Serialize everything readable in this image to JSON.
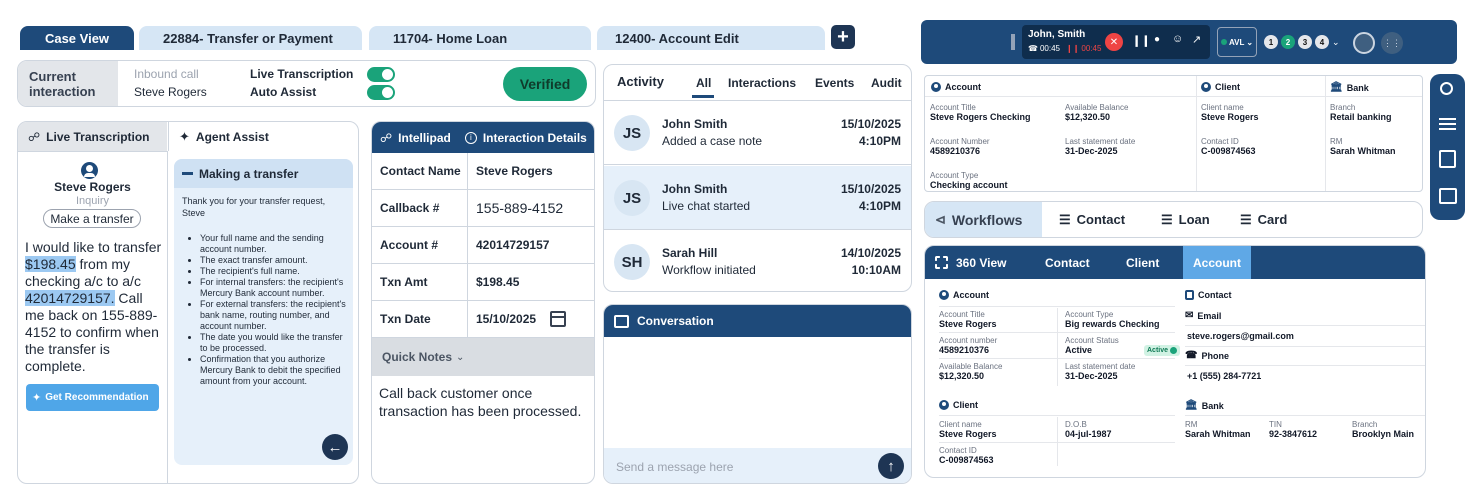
{
  "tabs": [
    {
      "label": "Case View"
    },
    {
      "label": "22884- Transfer or Payment"
    },
    {
      "label": "11704- Home Loan"
    },
    {
      "label": "12400- Account Edit"
    }
  ],
  "add_tab_icon": "plus-icon",
  "current_interaction": {
    "label": "Current interaction",
    "channel": "Inbound call",
    "customer": "Steve Rogers",
    "live_transcription_label": "Live Transcription",
    "auto_assist_label": "Auto Assist",
    "verified_label": "Verified",
    "toggle_color": "#1aa37a"
  },
  "transcription": {
    "tab_label": "Live Transcription",
    "agent_assist_label": "Agent Assist",
    "caller_name": "Steve Rogers",
    "caller_type": "Inquiry",
    "intent_chip": "Make a transfer",
    "text_parts": [
      "I would like to transfer ",
      "$198.45",
      " from my checking a/c to a/c ",
      "42014729157.",
      " Call me back on 155-889-4152 to confirm when the transfer is complete."
    ],
    "recommend_button": "Get Recommendation"
  },
  "agent_assist": {
    "title": "Making a transfer",
    "intro": "Thank you for your transfer request, Steve",
    "steps": [
      "Your full name and the sending account number.",
      "The exact transfer amount.",
      "The recipient's full name.",
      "For internal transfers: the recipient's Mercury Bank account number.",
      "For external transfers: the recipient's bank name, routing number, and account number.",
      "The date you would like the transfer to be processed.",
      "Confirmation that you authorize Mercury Bank to debit the specified amount from your account."
    ]
  },
  "intellipad": {
    "tab_label": "Intellipad",
    "details_label": "Interaction Details",
    "rows": [
      {
        "key": "Contact Name",
        "value": "Steve Rogers"
      },
      {
        "key": "Callback #",
        "value": "155-889-4152"
      },
      {
        "key": "Account #",
        "value": "42014729157"
      },
      {
        "key": "Txn Amt",
        "value": "$198.45"
      },
      {
        "key": "Txn Date",
        "value": "15/10/2025"
      }
    ],
    "quick_notes_label": "Quick Notes",
    "note": "Call back customer once transaction has been processed."
  },
  "activity": {
    "title": "Activity",
    "filters": [
      "All",
      "Interactions",
      "Events",
      "Audit"
    ],
    "items": [
      {
        "initials": "JS",
        "name": "John Smith",
        "action": "Added a case note",
        "date": "15/10/2025",
        "time": "4:10PM"
      },
      {
        "initials": "JS",
        "name": "John Smith",
        "action": "Live chat started",
        "date": "15/10/2025",
        "time": "4:10PM"
      },
      {
        "initials": "SH",
        "name": "Sarah Hill",
        "action": "Workflow initiated",
        "date": "14/10/2025",
        "time": "10:10AM"
      }
    ]
  },
  "conversation": {
    "title": "Conversation",
    "placeholder": "Send a message here"
  },
  "call_bar": {
    "caller": "John, Smith",
    "timer": "00:45",
    "hold_timer": "00:45",
    "status": "AVL",
    "lines": [
      "1",
      "2",
      "3",
      "4"
    ],
    "status_color": "#1aa37a"
  },
  "account_summary": {
    "account_header": "Account",
    "client_header": "Client",
    "bank_header": "Bank",
    "account_title_label": "Account Title",
    "account_title": "Steve Rogers Checking",
    "balance_label": "Available Balance",
    "balance": "$12,320.50",
    "account_number_label": "Account Number",
    "account_number": "4589210376",
    "statement_label": "Last statement date",
    "statement": "31-Dec-2025",
    "account_type_label": "Account Type",
    "account_type": "Checking account",
    "client_name_label": "Client name",
    "client_name": "Steve Rogers",
    "contact_id_label": "Contact ID",
    "contact_id": "C-009874563",
    "branch_label": "Branch",
    "branch": "Retail banking",
    "rm_label": "RM",
    "rm": "Sarah Whitman"
  },
  "workflow_tabs": [
    "Workflows",
    "Contact",
    "Loan",
    "Card"
  ],
  "view360": {
    "tabs": [
      "360 View",
      "Contact",
      "Client",
      "Account"
    ],
    "account_header": "Account",
    "contact_header": "Contact",
    "client_header": "Client",
    "bank_header": "Bank",
    "account_title_label": "Account Title",
    "account_title": "Steve Rogers",
    "account_type_label": "Account Type",
    "account_type": "Big rewards Checking",
    "account_number_label": "Account number",
    "account_number": "4589210376",
    "account_status_label": "Account Status",
    "account_status": "Active",
    "active_badge": "Active",
    "balance_label": "Available Balance",
    "balance": "$12,320.50",
    "statement_label": "Last statement date",
    "statement": "31-Dec-2025",
    "email_label": "Email",
    "email": "steve.rogers@gmail.com",
    "phone_label": "Phone",
    "phone": "+1 (555) 284-7721",
    "client_name_label": "Client name",
    "client_name": "Steve Rogers",
    "dob_label": "D.O.B",
    "dob": "04-jul-1987",
    "contact_id_label": "Contact ID",
    "contact_id": "C-009874563",
    "rm_label": "RM",
    "rm": "Sarah Whitman",
    "tin_label": "TIN",
    "tin": "92-3847612",
    "branch_label": "Branch",
    "branch": "Brooklyn Main"
  },
  "side_toolbar": [
    "search-icon",
    "menu-icon",
    "book-icon",
    "chat-icon"
  ],
  "colors": {
    "navy": "#1e4a7a",
    "accent": "#1aa37a",
    "light_blue": "#d6e6f5"
  }
}
